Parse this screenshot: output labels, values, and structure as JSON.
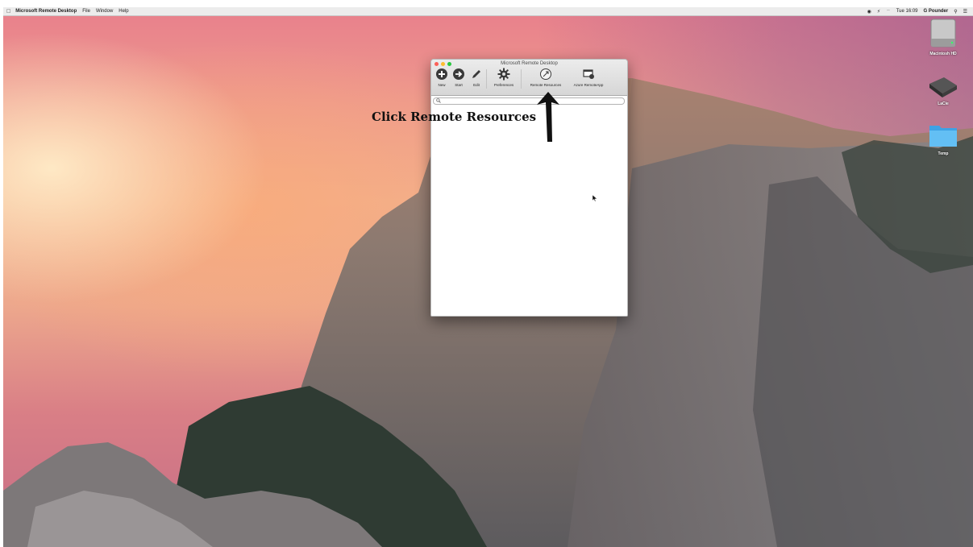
{
  "menubar": {
    "apple_icon": "apple-logo-icon",
    "app_name": "Microsoft Remote Desktop",
    "items": [
      "File",
      "Window",
      "Help"
    ],
    "status": {
      "record_icon": "record-icon",
      "battery_text": "⚡︎",
      "wifi_icon": "wifi-icon",
      "clock": "Tue 16:09",
      "user": "G Pounder",
      "search_icon": "spotlight-icon",
      "list_icon": "notification-center-icon"
    }
  },
  "desktop_icons": [
    {
      "label": "Macintosh HD",
      "icon": "hard-drive-icon"
    },
    {
      "label": "LaCie",
      "icon": "external-drive-icon"
    },
    {
      "label": "Temp",
      "icon": "folder-icon"
    }
  ],
  "window": {
    "title": "Microsoft Remote Desktop",
    "toolbar": {
      "new": "New",
      "start": "Start",
      "edit": "Edit",
      "preferences": "Preferences",
      "remote_resources": "Remote Resources",
      "azure_remoteapp": "Azure RemoteApp"
    },
    "search": {
      "value": "",
      "placeholder": ""
    }
  },
  "annotation": {
    "text": "Click Remote Resources"
  },
  "colors": {
    "close": "#fc5f57",
    "minimize": "#fdbc2e",
    "maximize": "#28c840"
  }
}
